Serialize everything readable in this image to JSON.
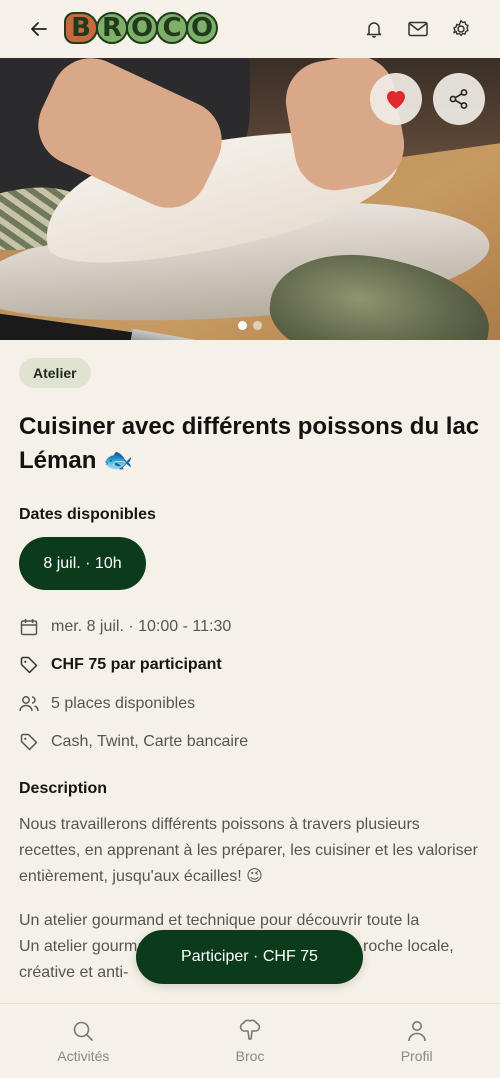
{
  "header": {
    "logo_text": "BROCO",
    "logo_letters": [
      "B",
      "R",
      "O",
      "C",
      "O"
    ],
    "icons": [
      "back-arrow-icon",
      "bell-icon",
      "mail-icon",
      "gear-icon"
    ]
  },
  "hero": {
    "image_alt": "pike fish being filleted on wooden cutting board",
    "like_icon": "heart-icon",
    "share_icon": "share-icon",
    "like_color": "#e0282f",
    "carousel_count": 2,
    "carousel_active": 1
  },
  "event": {
    "category": "Atelier",
    "title": "Cuisiner avec différents poissons du lac Léman 🐟",
    "dates_label": "Dates disponibles",
    "date_option": "8 juil. · 10h",
    "schedule": "mer. 8 juil. · 10:00 - 11:30",
    "price": "CHF 75 par participant",
    "places": "5 places disponibles",
    "payment": "Cash, Twint, Carte bancaire",
    "description_label": "Description",
    "description_p1": "Nous travaillerons différents poissons à travers plusieurs recettes, en apprenant à les préparer, les cuisiner et les valoriser entièrement, jusqu'aux écailles! 😉",
    "description_p2_start": "Un atelier gourmand et technique pour découvrir toute la richesse des po",
    "description_p2_end": "roche locale,",
    "description_p3": "créative et anti-"
  },
  "cta": {
    "label": "Participer · CHF 75"
  },
  "nav": {
    "items": [
      {
        "label": "Activités",
        "icon": "search-icon"
      },
      {
        "label": "Broc",
        "icon": "broccoli-icon"
      },
      {
        "label": "Profil",
        "icon": "user-icon"
      }
    ]
  },
  "colors": {
    "background": "#f5f1e8",
    "primary": "#0c3b1c",
    "badge_bg": "#e1e3d2"
  }
}
